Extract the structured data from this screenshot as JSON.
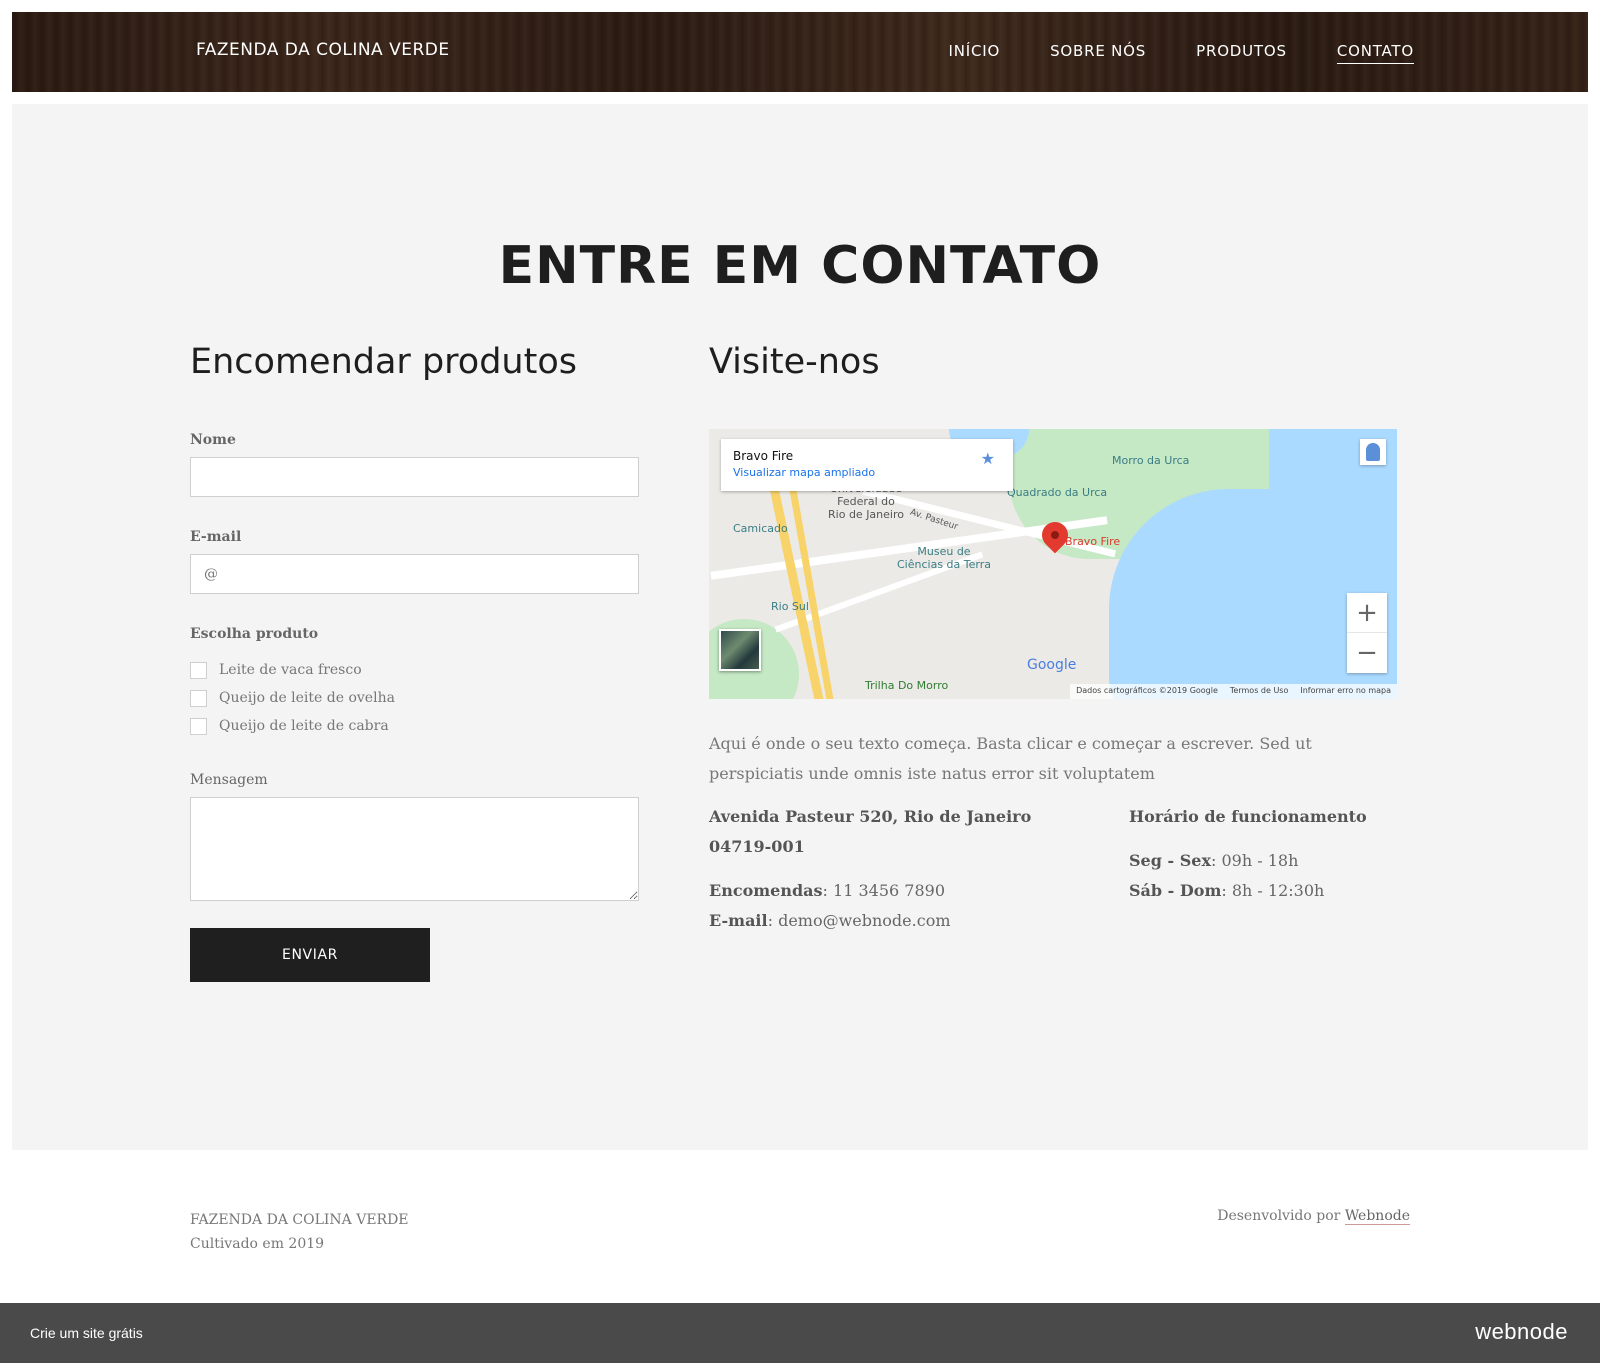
{
  "header": {
    "brand": "FAZENDA DA COLINA VERDE",
    "nav": [
      {
        "label": "INÍCIO",
        "active": false
      },
      {
        "label": "SOBRE NÓS",
        "active": false
      },
      {
        "label": "PRODUTOS",
        "active": false
      },
      {
        "label": "CONTATO",
        "active": true
      }
    ]
  },
  "main": {
    "title": "ENTRE EM CONTATO",
    "form": {
      "heading": "Encomendar produtos",
      "name_label": "Nome",
      "name_value": "",
      "email_label": "E-mail",
      "email_placeholder": "@",
      "products_label": "Escolha produto",
      "products": [
        {
          "label": "Leite de vaca fresco",
          "checked": false
        },
        {
          "label": "Queijo de leite de ovelha",
          "checked": false
        },
        {
          "label": "Queijo de leite de cabra",
          "checked": false
        }
      ],
      "message_label": "Mensagem",
      "message_value": "",
      "submit_label": "ENVIAR"
    },
    "visit": {
      "heading": "Visite-nos",
      "map": {
        "place_title": "Bravo Fire",
        "place_link": "Visualizar mapa ampliado",
        "labels": {
          "morro_urca": "Morro da Urca",
          "quadrado_urca": "Quadrado da Urca",
          "bravo_fire": "Bravo Fire",
          "universidade": "Universidade\nFederal do\nRio de Janeiro",
          "camicado": "Camicado",
          "museu": "Museu de\nCiências da Terra",
          "rio_sul": "Rio Sul",
          "trilha": "Trilha Do Morro",
          "av_pasteur": "Av. Pasteur"
        },
        "google": "Google",
        "attribution": [
          "Dados cartográficos ©2019 Google",
          "Termos de Uso",
          "Informar erro no mapa"
        ],
        "zoom_in": "+",
        "zoom_out": "−"
      },
      "description": "Aqui é onde o seu texto começa. Basta clicar e começar a escrever. Sed ut perspiciatis unde omnis iste natus error sit voluptatem",
      "address_line1": "Avenida Pasteur 520, Rio de Janeiro",
      "address_line2": "04719-001",
      "orders_label": "Encomendas",
      "orders_value": ": 11 3456 7890",
      "email_label": "E-mail",
      "email_value": ": demo@webnode.com",
      "hours_title": "Horário de funcionamento",
      "hours": [
        {
          "days": "Seg - Sex",
          "time": ": 09h - 18h"
        },
        {
          "days": "Sáb - Dom",
          "time": ": 8h - 12:30h"
        }
      ]
    }
  },
  "footer": {
    "name": "FAZENDA DA COLINA VERDE",
    "since": "Cultivado em 2019",
    "powered_prefix": "Desenvolvido por ",
    "powered_link": "Webnode"
  },
  "bottombar": {
    "cta": "Crie um site grátis",
    "logo": "webnode"
  }
}
